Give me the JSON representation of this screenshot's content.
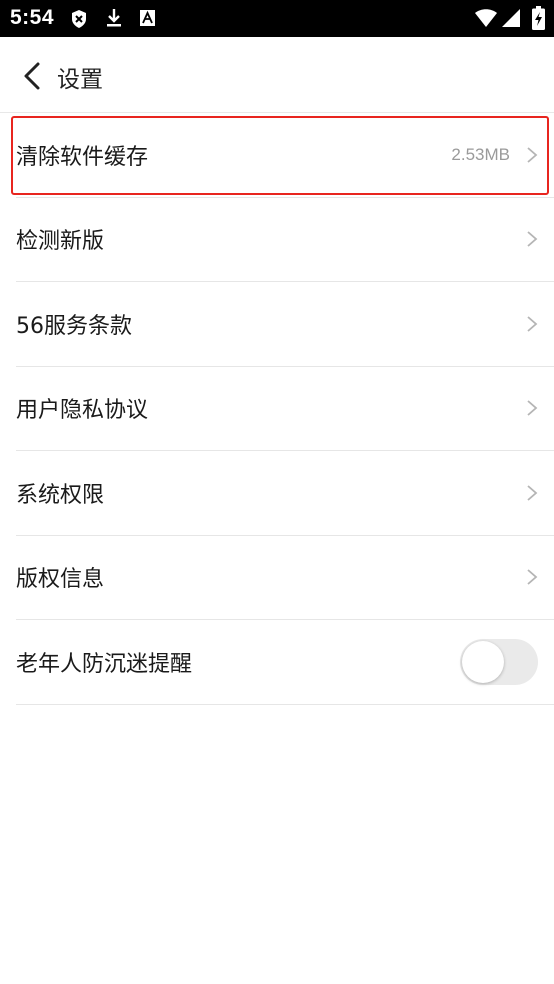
{
  "status_bar": {
    "time": "5:54",
    "icons": [
      "shield-x-icon",
      "download-icon",
      "text-a-icon",
      "wifi-icon",
      "signal-icon",
      "battery-charging-icon"
    ]
  },
  "header": {
    "title": "设置",
    "back_icon": "chevron-left-icon"
  },
  "settings": {
    "items": [
      {
        "label": "清除软件缓存",
        "value": "2.53MB",
        "highlighted": true
      },
      {
        "label": "检测新版"
      },
      {
        "label": "56服务条款"
      },
      {
        "label": "用户隐私协议"
      },
      {
        "label": "系统权限"
      },
      {
        "label": "版权信息"
      },
      {
        "label": "老年人防沉迷提醒",
        "toggle": "off"
      }
    ]
  },
  "colors": {
    "highlight_border": "#e8251f",
    "toggle_track": "#eaeaea"
  }
}
